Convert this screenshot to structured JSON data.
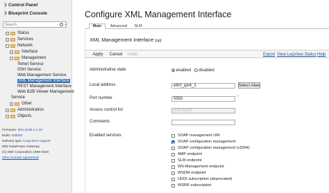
{
  "sidebar": {
    "control_panel": "Control Panel",
    "blueprint_console": "Blueprint Console",
    "search_placeholder": "Search",
    "collapse_glyph": "«",
    "tree": [
      {
        "label": "Status",
        "toggle": "+"
      },
      {
        "label": "Services",
        "toggle": "+"
      },
      {
        "label": "Network",
        "toggle": "−"
      },
      {
        "label": "Interface",
        "toggle": "+"
      },
      {
        "label": "Management",
        "toggle": "−"
      },
      {
        "label": "Telnet Service"
      },
      {
        "label": "SSH Service"
      },
      {
        "label": "Web Management Service"
      },
      {
        "label": "XML Management Interface"
      },
      {
        "label": "REST Management Interface"
      },
      {
        "label": "Web B2B Viewer Management"
      },
      {
        "label": "Service"
      },
      {
        "label": "Other",
        "toggle": "+"
      },
      {
        "label": "Administration",
        "toggle": "+"
      },
      {
        "label": "Objects",
        "toggle": "+"
      }
    ],
    "firmware_label": "Firmware:",
    "firmware_value": "IDG.2018.4.1.16",
    "build_label": "Build:",
    "build_value": "318002",
    "delivery_label": "Delivery type:",
    "delivery_value": "Long-term support",
    "product": "IBM DataPower Gateway",
    "copyright": "(C) IBM Corporation 1999-2020",
    "license": "View License Agreement"
  },
  "main": {
    "title": "Configure XML Management Interface",
    "tabs": [
      "Main",
      "Advanced",
      "SLM"
    ],
    "form_title": "XML Management Interface",
    "mode": "[up]",
    "toolbar": {
      "apply": "Apply",
      "cancel": "Cancel",
      "undo": "Undo",
      "export": "Export",
      "view_log": "View Log",
      "view_status": "View Status",
      "help": "Help"
    },
    "fields": {
      "admin_state_label": "Administrative state",
      "enabled": "enabled",
      "disabled": "disabled",
      "local_address_label": "Local address",
      "local_address_value": "eth0_ipv4_1",
      "select_alias": "Select Alias",
      "port_label": "Port number",
      "port_value": "5550",
      "acl_label": "Access control list",
      "acl_value": "xml-mgmt",
      "comments_label": "Comments",
      "enabled_services_label": "Enabled services"
    },
    "services": [
      {
        "label": "SOAP management URI",
        "checked": false
      },
      {
        "label": "SOAP configuration management",
        "checked": true
      },
      {
        "label": "SOAP configuration management (v2004)",
        "checked": false
      },
      {
        "label": "AMP endpoint",
        "checked": false
      },
      {
        "label": "SLM endpoint",
        "checked": false
      },
      {
        "label": "WS-Management endpoint",
        "checked": false
      },
      {
        "label": "WSDM endpoint",
        "checked": false
      },
      {
        "label": "UDDI subscription (deprecated)",
        "checked": false
      },
      {
        "label": "WSRR subscription",
        "checked": false
      }
    ]
  }
}
